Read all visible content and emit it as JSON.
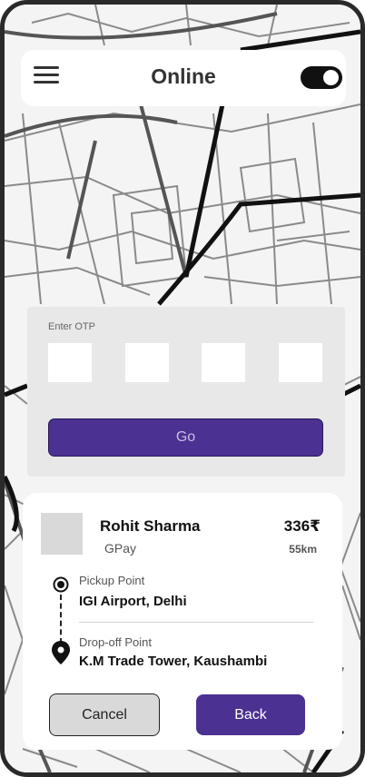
{
  "header": {
    "title": "Online",
    "online_toggle_on": true
  },
  "otp": {
    "label": "Enter OTP",
    "digits": [
      "",
      "",
      "",
      ""
    ],
    "go_label": "Go"
  },
  "ride": {
    "rider_name": "Rohit Sharma",
    "payment_method": "GPay",
    "fare": "336₹",
    "distance": "55km",
    "pickup_label": "Pickup Point",
    "pickup_value": "IGI Airport, Delhi",
    "drop_label": "Drop-off Point",
    "drop_value": "K.M Trade Tower, Kaushambi"
  },
  "actions": {
    "cancel_label": "Cancel",
    "back_label": "Back"
  },
  "colors": {
    "accent": "#4b3191",
    "map_bg": "#f4f4f4",
    "panel_bg": "#e8e8e8"
  },
  "icons": {
    "menu": "menu-icon",
    "pickup": "pickup-point-icon",
    "dropoff": "map-pin-icon"
  }
}
